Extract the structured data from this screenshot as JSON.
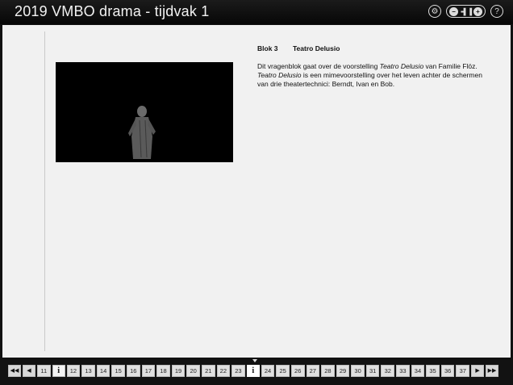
{
  "app": {
    "title": "2019 VMBO drama - tijdvak 1"
  },
  "toolbar": {
    "icons": [
      "settings-icon",
      "volume-control-icon",
      "help-icon"
    ],
    "help_glyph": "?"
  },
  "main": {
    "block_label": "Blok 3",
    "block_title": "Teatro Delusio",
    "paragraph_1": "Dit vragenblok gaat over de voorstelling ",
    "paragraph_2": "Teatro Delusio",
    "paragraph_3": " van Familie Flöz. ",
    "paragraph_4": "Teatro Delusio",
    "paragraph_5": " is een mimevoorstelling over het leven achter de schermen van drie theatertechnici: Berndt, Ivan en Bob."
  },
  "nav": {
    "first": "◀◀",
    "prev": "◀",
    "next": "▶",
    "last": "▶▶",
    "info_glyph": "i",
    "pages_before": [
      "11"
    ],
    "pages_a": [
      "12",
      "13",
      "14",
      "15",
      "16",
      "17",
      "18",
      "19",
      "20",
      "21",
      "22",
      "23"
    ],
    "pages_b": [
      "24",
      "25",
      "26",
      "27",
      "28",
      "29",
      "30",
      "31",
      "32",
      "33",
      "34",
      "35",
      "36",
      "37"
    ]
  }
}
